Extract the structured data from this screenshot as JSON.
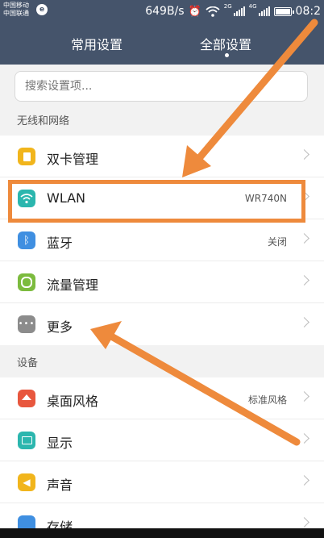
{
  "status_bar": {
    "carrier_1": "中国移动",
    "carrier_2": "中国联通",
    "carrier_badge": "e",
    "speed": "649B/s",
    "net_tag_1": "2G",
    "net_tag_2": "4G",
    "time": "08:2"
  },
  "header": {
    "tabs": [
      {
        "label": "常用设置",
        "active": false
      },
      {
        "label": "全部设置",
        "active": true
      }
    ]
  },
  "search": {
    "placeholder": "搜索设置项..."
  },
  "sections": [
    {
      "title": "无线和网络",
      "items": [
        {
          "label": "双卡管理",
          "value": "",
          "icon": "sim-card-icon",
          "color": "#f1b51c"
        },
        {
          "label": "WLAN",
          "value": "WR740N",
          "icon": "wifi-icon",
          "color": "#2bb6ae"
        },
        {
          "label": "蓝牙",
          "value": "关闭",
          "icon": "bluetooth-icon",
          "color": "#3f8fe1"
        },
        {
          "label": "流量管理",
          "value": "",
          "icon": "data-usage-icon",
          "color": "#7cbb3e"
        },
        {
          "label": "更多",
          "value": "",
          "icon": "more-icon",
          "color": "#8c8c8c"
        }
      ]
    },
    {
      "title": "设备",
      "items": [
        {
          "label": "桌面风格",
          "value": "标准风格",
          "icon": "home-icon",
          "color": "#e8573e"
        },
        {
          "label": "显示",
          "value": "",
          "icon": "display-icon",
          "color": "#2bb6ae"
        },
        {
          "label": "声音",
          "value": "",
          "icon": "sound-icon",
          "color": "#f1b51c"
        },
        {
          "label": "存储",
          "value": "",
          "icon": "storage-icon",
          "color": "#3f8fe1"
        }
      ]
    }
  ],
  "annotation_color": "#ee8a3c",
  "header_color": "#45546b"
}
